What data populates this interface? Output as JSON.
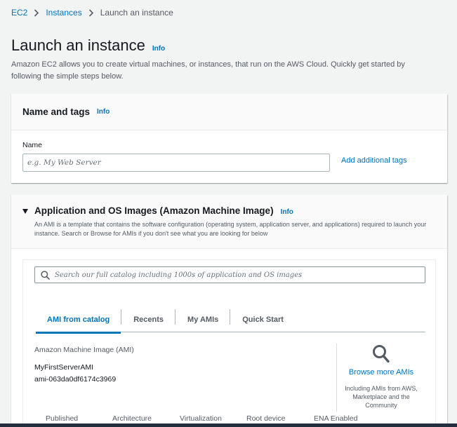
{
  "breadcrumb": {
    "items": [
      "EC2",
      "Instances"
    ],
    "current": "Launch an instance"
  },
  "page": {
    "title": "Launch an instance",
    "info": "Info",
    "description": "Amazon EC2 allows you to create virtual machines, or instances, that run on the AWS Cloud. Quickly get started by following the simple steps below."
  },
  "name_tags": {
    "title": "Name and tags",
    "info": "Info",
    "name_label": "Name",
    "name_placeholder": "e.g. My Web Server",
    "add_tags": "Add additional tags"
  },
  "ami": {
    "title": "Application and OS Images (Amazon Machine Image)",
    "info": "Info",
    "description": "An AMI is a template that contains the software configuration (operating system, application server, and applications) required to launch your instance. Search or Browse for AMIs if you don't see what you are looking for below",
    "search_placeholder": "Search our full catalog including 1000s of application and OS images",
    "tabs": [
      "AMI from catalog",
      "Recents",
      "My AMIs",
      "Quick Start"
    ],
    "active_tab": 0,
    "selected_label": "Amazon Machine Image (AMI)",
    "selected_name": "MyFirstServerAMI",
    "selected_id": "ami-063da0df6174c3969",
    "browse_link": "Browse more AMIs",
    "browse_note": "Including AMIs from AWS, Marketplace and the Community",
    "columns": [
      "Published",
      "Architecture",
      "Virtualization",
      "Root device",
      "ENA Enabled"
    ]
  },
  "colors": {
    "link": "#0073bb",
    "text": "#16191f",
    "muted": "#545b64",
    "background": "#f2f3f3"
  }
}
